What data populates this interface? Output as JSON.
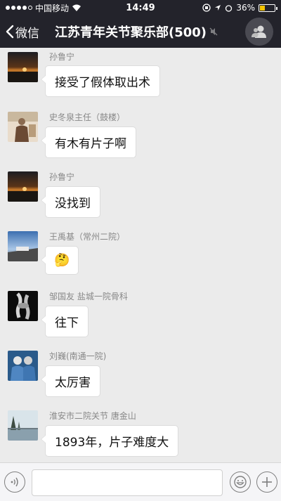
{
  "status_bar": {
    "carrier": "中国移动",
    "time": "14:49",
    "battery": "36%"
  },
  "nav": {
    "back_label": "微信",
    "title": "江苏青年关节聚乐部(500)"
  },
  "messages": [
    {
      "sender": "孙鲁宁",
      "text": "接受了假体取出术"
    },
    {
      "sender": "史冬泉主任（鼓楼）",
      "text": "有木有片子啊"
    },
    {
      "sender": "孙鲁宁",
      "text": "没找到"
    },
    {
      "sender": "王禹基（常州二院）",
      "text": "",
      "emoji": "🤔"
    },
    {
      "sender": "邹国友 盐城一院骨科",
      "text": "往下"
    },
    {
      "sender": "刘巍(南通一院)",
      "text": "太厉害"
    },
    {
      "sender": "淮安市二院关节 唐金山",
      "text": "1893年，片子难度大"
    }
  ],
  "input": {
    "placeholder": ""
  },
  "colors": {
    "header_bg": "#23232b",
    "chat_bg": "#ebebeb",
    "bubble_bg": "#ffffff"
  }
}
